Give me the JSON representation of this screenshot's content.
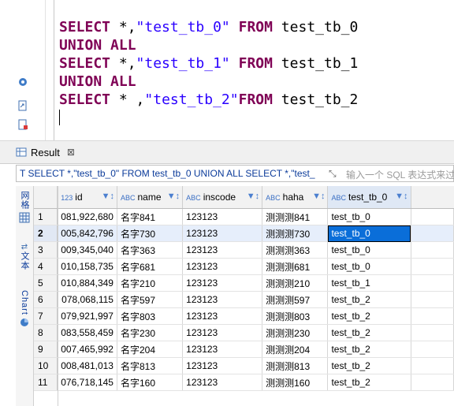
{
  "editor": {
    "lines": [
      [
        {
          "t": "SELECT",
          "c": "kw"
        },
        {
          "t": " *,"
        },
        {
          "t": "\"test_tb_0\"",
          "c": "str"
        },
        {
          "t": " "
        },
        {
          "t": "FROM",
          "c": "kw"
        },
        {
          "t": " test_tb_0"
        }
      ],
      [
        {
          "t": "UNION",
          "c": "kw"
        },
        {
          "t": " "
        },
        {
          "t": "ALL",
          "c": "kw"
        }
      ],
      [
        {
          "t": "SELECT",
          "c": "kw"
        },
        {
          "t": " *,"
        },
        {
          "t": "\"test_tb_1\"",
          "c": "str"
        },
        {
          "t": " "
        },
        {
          "t": "FROM",
          "c": "kw"
        },
        {
          "t": " test_tb_1"
        }
      ],
      [
        {
          "t": "UNION",
          "c": "kw"
        },
        {
          "t": " "
        },
        {
          "t": "ALL",
          "c": "kw"
        }
      ],
      [
        {
          "t": "SELECT",
          "c": "kw"
        },
        {
          "t": " * ,"
        },
        {
          "t": "\"test_tb_2\"",
          "c": "str"
        },
        {
          "t": "FROM",
          "c": "kw"
        },
        {
          "t": " test_tb_2"
        }
      ]
    ]
  },
  "result": {
    "tab_label": "Result",
    "filter_text": "T SELECT *,\"test_tb_0\" FROM test_tb_0 UNION ALL SELECT *,\"test_",
    "filter_placeholder": "输入一个 SQL 表达式来过",
    "side_tabs": {
      "grid": "网格",
      "text": "文本",
      "chart": "Chart"
    },
    "columns": [
      {
        "type": "123",
        "name": "id"
      },
      {
        "type": "ABC",
        "name": "name"
      },
      {
        "type": "ABC",
        "name": "inscode"
      },
      {
        "type": "ABC",
        "name": "haha"
      },
      {
        "type": "ABC",
        "name": "test_tb_0"
      }
    ],
    "selected_row": 2,
    "rows": [
      {
        "n": "1",
        "id": "081,922,680",
        "name": "名字841",
        "inscode": "123123",
        "haha": "测测测841",
        "tb": "test_tb_0"
      },
      {
        "n": "2",
        "id": "005,842,796",
        "name": "名字730",
        "inscode": "123123",
        "haha": "测测测730",
        "tb": "test_tb_0"
      },
      {
        "n": "3",
        "id": "009,345,040",
        "name": "名字363",
        "inscode": "123123",
        "haha": "测测测363",
        "tb": "test_tb_0"
      },
      {
        "n": "4",
        "id": "010,158,735",
        "name": "名字681",
        "inscode": "123123",
        "haha": "测测测681",
        "tb": "test_tb_0"
      },
      {
        "n": "5",
        "id": "010,884,349",
        "name": "名字210",
        "inscode": "123123",
        "haha": "测测测210",
        "tb": "test_tb_1"
      },
      {
        "n": "6",
        "id": "078,068,115",
        "name": "名字597",
        "inscode": "123123",
        "haha": "测测测597",
        "tb": "test_tb_2"
      },
      {
        "n": "7",
        "id": "079,921,997",
        "name": "名字803",
        "inscode": "123123",
        "haha": "测测测803",
        "tb": "test_tb_2"
      },
      {
        "n": "8",
        "id": "083,558,459",
        "name": "名字230",
        "inscode": "123123",
        "haha": "测测测230",
        "tb": "test_tb_2"
      },
      {
        "n": "9",
        "id": "007,465,992",
        "name": "名字204",
        "inscode": "123123",
        "haha": "测测测204",
        "tb": "test_tb_2"
      },
      {
        "n": "10",
        "id": "008,481,013",
        "name": "名字813",
        "inscode": "123123",
        "haha": "测测测813",
        "tb": "test_tb_2"
      },
      {
        "n": "11",
        "id": "076,718,145",
        "name": "名字160",
        "inscode": "123123",
        "haha": "测测测160",
        "tb": "test_tb_2"
      }
    ]
  }
}
